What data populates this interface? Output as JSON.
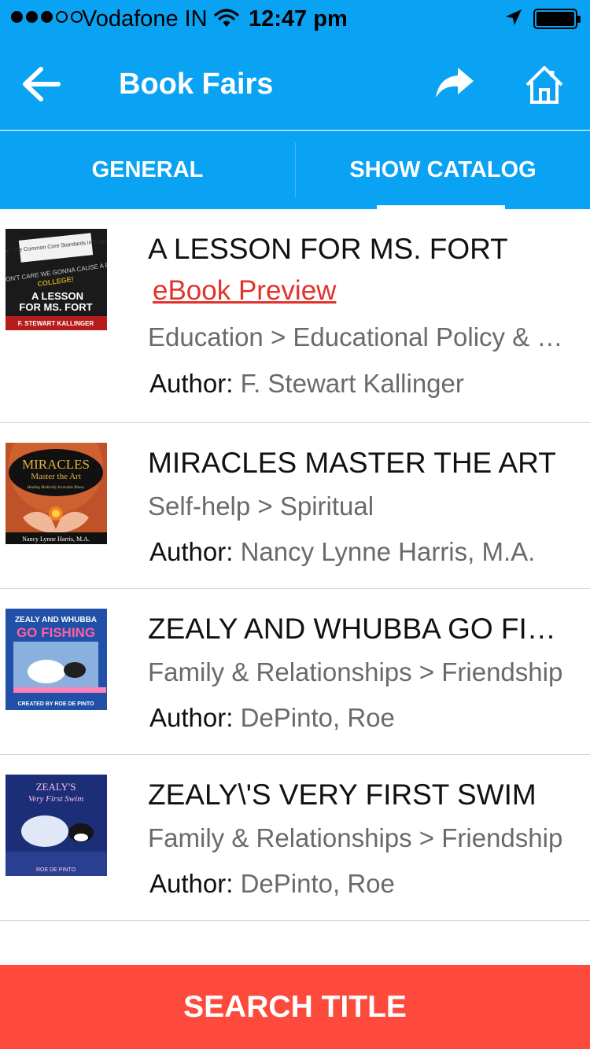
{
  "status_bar": {
    "signal_filled": 3,
    "signal_total": 5,
    "carrier": "Vodafone IN",
    "time": "12:47 pm",
    "icons": [
      "wifi-icon",
      "location-arrow-icon",
      "battery-icon"
    ]
  },
  "nav": {
    "title": "Book Fairs",
    "icons": [
      "back-arrow-icon",
      "share-icon",
      "home-icon"
    ]
  },
  "tabs": [
    {
      "label": "GENERAL",
      "selected": false
    },
    {
      "label": "SHOW CATALOG",
      "selected": true
    }
  ],
  "books": [
    {
      "title": "A LESSON FOR MS. FORT",
      "preview": "eBook Preview",
      "category": "Education > Educational Policy & Reform",
      "author_label": "Author:",
      "author": "F. Stewart Kallinger",
      "cover": {
        "lines": [
          "Aim: The Common Core Standards in English",
          "WE DON'T CARE WE GONNA CAUSE A FUSS",
          "A LESSON",
          "FOR MS. FORT",
          "F. STEWART KALLINGER"
        ]
      }
    },
    {
      "title": "MIRACLES MASTER THE ART",
      "category": "Self-help > Spiritual",
      "author_label": "Author:",
      "author": "Nancy Lynne Harris, M.A.",
      "cover": {
        "lines": [
          "MIRACLES",
          "Master the Art",
          "Healing Medically Incurable Illness",
          "Nancy Lynne Harris, M.A."
        ]
      }
    },
    {
      "title": "ZEALY AND WHUBBA GO FISHING",
      "category": "Family & Relationships > Friendship",
      "author_label": "Author:",
      "author": "DePinto, Roe",
      "cover": {
        "lines": [
          "ZEALY AND WHUBBA",
          "GO FISHING",
          "CREATED BY ROE DE PINTO"
        ]
      }
    },
    {
      "title": "ZEALY\\'S VERY FIRST SWIM",
      "category": "Family & Relationships > Friendship",
      "author_label": "Author:",
      "author": "DePinto, Roe",
      "cover": {
        "lines": [
          "ZEALY'S",
          "Very First Swim",
          "ROE DE PINTO"
        ]
      }
    }
  ],
  "search_button": "SEARCH TITLE",
  "colors": {
    "primary": "#0aa2f2",
    "accent_red": "#fe4a3c",
    "link_red": "#e2322c",
    "divider": "#d5d5d5"
  }
}
